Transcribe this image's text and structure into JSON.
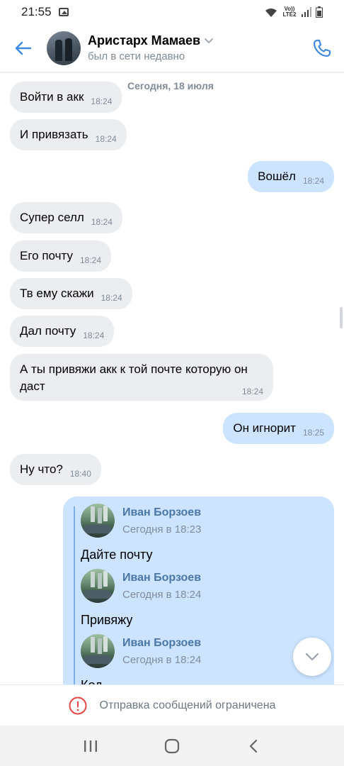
{
  "status_bar": {
    "time": "21:55",
    "network_label": "Vo)) LTE2"
  },
  "header": {
    "contact_name": "Аристарх Мамаев",
    "last_seen": "был в сети недавно"
  },
  "chat": {
    "date_chip": "Сегодня, 18 июля",
    "messages": [
      {
        "text": "Войти в акк",
        "time": "18:24",
        "dir": "in"
      },
      {
        "text": "И привязать",
        "time": "18:24",
        "dir": "in"
      },
      {
        "text": "Вошёл",
        "time": "18:24",
        "dir": "out"
      },
      {
        "text": "Супер селл",
        "time": "18:24",
        "dir": "in"
      },
      {
        "text": "Его почту",
        "time": "18:24",
        "dir": "in"
      },
      {
        "text": "Тв ему скажи",
        "time": "18:24",
        "dir": "in"
      },
      {
        "text": "Дал почту",
        "time": "18:24",
        "dir": "in"
      },
      {
        "text": "А ты привяжи акк к той почте которую он даст",
        "time": "18:24",
        "dir": "in"
      },
      {
        "text": "Он игнорит",
        "time": "18:25",
        "dir": "out"
      },
      {
        "text": "Ну что?",
        "time": "18:40",
        "dir": "in"
      }
    ],
    "forwarded": [
      {
        "author": "Иван Борзоев",
        "time": "Сегодня в 18:23",
        "text": "Дайте почту"
      },
      {
        "author": "Иван Борзоев",
        "time": "Сегодня в 18:24",
        "text": "Привяжу"
      },
      {
        "author": "Иван Борзоев",
        "time": "Сегодня в 18:24",
        "text": "Код"
      }
    ]
  },
  "footer": {
    "restricted_text": "Отправка сообщений ограничена"
  },
  "colors": {
    "accent": "#3f8ae0",
    "incoming_bubble": "#ebedf0",
    "outgoing_bubble": "#cce4ff",
    "forward_name": "#4a76a8",
    "secondary_text": "#818c99",
    "error_icon": "#e64646"
  },
  "icons": [
    "back-arrow-icon",
    "chevron-down-icon",
    "phone-icon",
    "scroll-down-icon",
    "error-icon",
    "recents-icon",
    "home-icon",
    "back-nav-icon"
  ]
}
